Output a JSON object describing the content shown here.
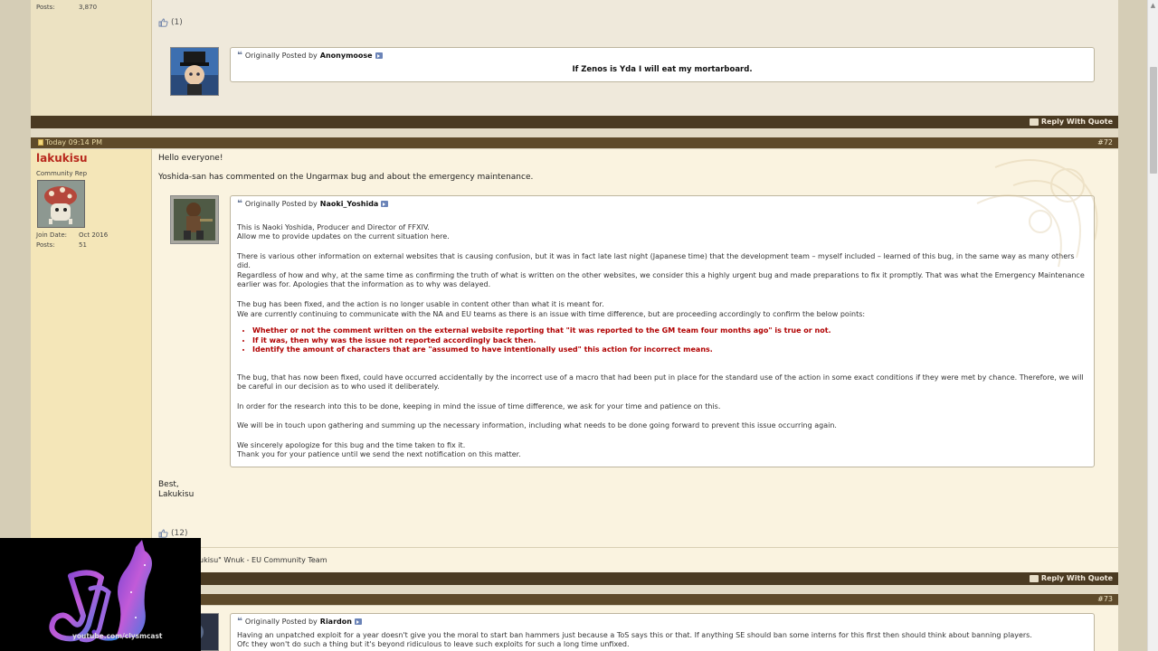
{
  "post71": {
    "stats": [
      {
        "label": "Posts:",
        "value": "3,870"
      }
    ],
    "likes": "(1)",
    "quote": {
      "prefix": "Originally Posted by",
      "author": "Anonymoose",
      "text": "If Zenos is Yda I will eat my mortarboard."
    },
    "reply_with_quote": "Reply With Quote"
  },
  "post72": {
    "date": "Today 09:14 PM",
    "number": "#72",
    "username": "lakukisu",
    "usertitle": "Community Rep",
    "stats": [
      {
        "label": "Join Date:",
        "value": "Oct 2016"
      },
      {
        "label": "Posts:",
        "value": "51"
      }
    ],
    "greeting": "Hello everyone!",
    "intro": "Yoshida-san has commented on the Ungarmax bug and about the emergency maintenance.",
    "quote": {
      "prefix": "Originally Posted by",
      "author": "Naoki_Yoshida",
      "p1a": "This is Naoki Yoshida, Producer and Director of FFXIV.",
      "p1b": "Allow me to provide updates on the current situation here.",
      "p2": "There is various other information on external websites that is causing confusion, but it was in fact late last night (Japanese time) that the development team – myself included – learned of this bug, in the same way as many others did.",
      "p3": "Regardless of how and why, at the same time as confirming the truth of what is written on the other websites, we consider this a highly urgent bug and made preparations to fix it promptly. That was what the Emergency Maintenance earlier was for. Apologies that the information as to why was delayed.",
      "p4a": "The bug has been fixed, and the action is no longer usable in content other than what it is meant for.",
      "p4b": "We are currently continuing to communicate with the NA and EU teams as there is an issue with time difference, but are proceeding accordingly to confirm the below points:",
      "bullets": [
        "Whether or not the comment written on the external website reporting that \"it was reported to the GM team four months ago\" is true or not.",
        "If it was, then why was the issue not reported accordingly back then.",
        "Identify the amount of characters that are \"assumed to have intentionally used\" this action for incorrect means."
      ],
      "p5": "The bug, that has now been fixed, could have occurred accidentally by the incorrect use of a macro that had been put in place for the standard use of the action in some exact conditions if they were met by chance. Therefore, we will be careful in our decision as to who used it deliberately.",
      "p6": "In order for the research into this to be done, keeping in mind the issue of time difference, we ask for your time and patience on this.",
      "p7": "We will be in touch upon gathering and summing up the necessary information, including what needs to be done going forward to prevent this issue occurring again.",
      "p8a": "We sincerely apologize for this bug and the time taken to fix it.",
      "p8b": "Thank you for your patience until we send the next notification on this matter."
    },
    "closing1": "Best,",
    "closing2": "Lakukisu",
    "likes": "(12)",
    "signature": "ukisu\" Wnuk - EU Community Team",
    "reply_with_quote": "Reply With Quote"
  },
  "post73": {
    "number": "#73",
    "quote": {
      "prefix": "Originally Posted by",
      "author": "Riardon",
      "line1": "Having an unpatched exploit for a year doesn't give you the moral to start ban hammers just because a ToS says this or that. If anything SE should ban some interns for this first then should think about banning players.",
      "line2": "Ofc they won't do such a thing but it's beyond ridiculous to leave such exploits for such a long time unfixed."
    }
  },
  "overlay": {
    "url": "youtube.com/clysmcast"
  }
}
